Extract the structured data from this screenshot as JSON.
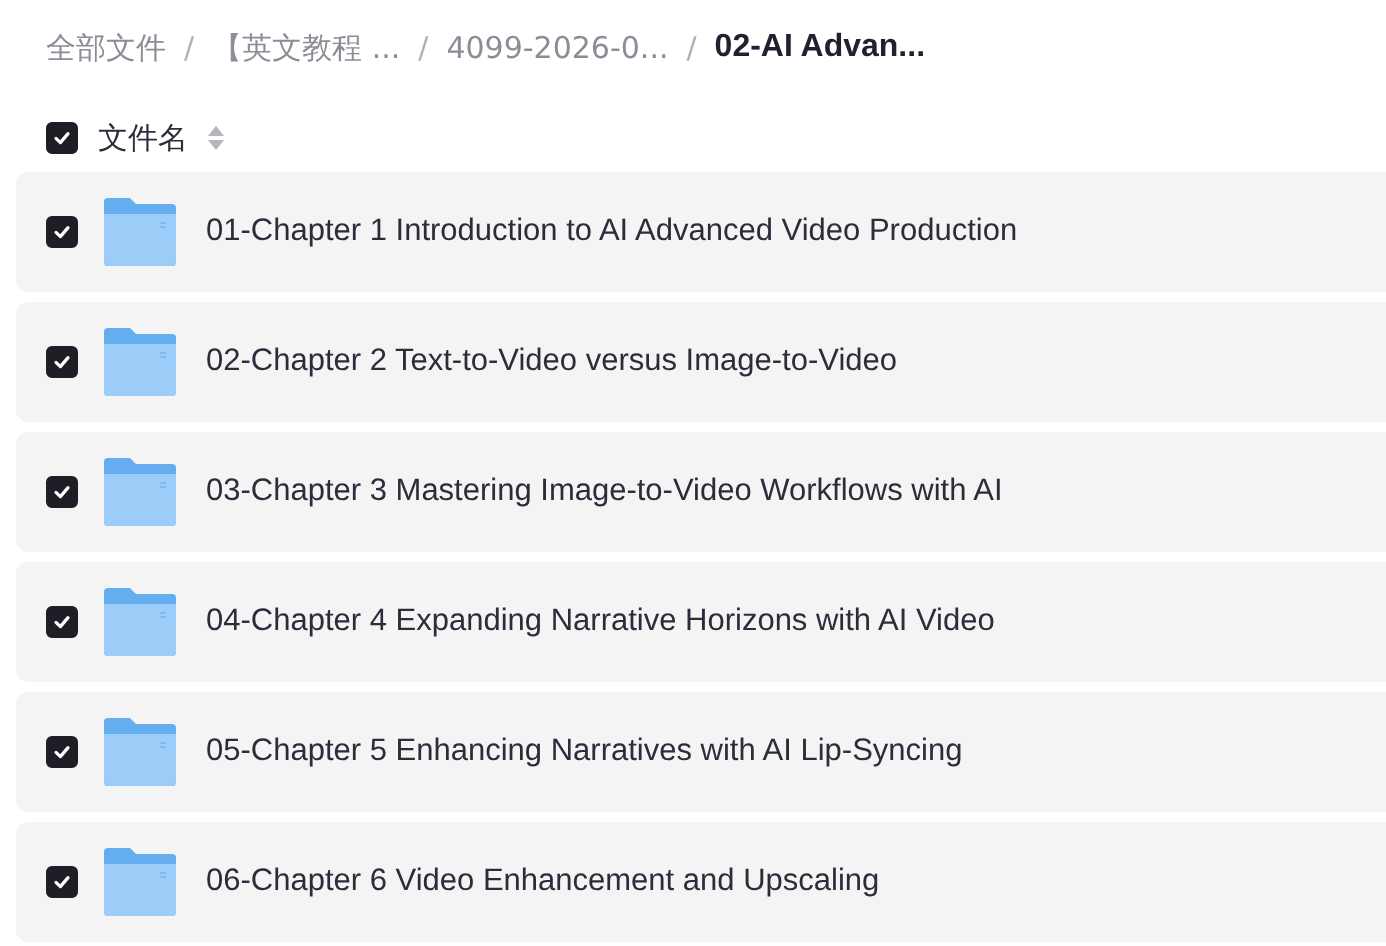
{
  "breadcrumb": [
    {
      "label": "全部文件",
      "current": false
    },
    {
      "separator": "/",
      "label": "【英文教程 ...",
      "current": false
    },
    {
      "separator": "/",
      "label": "4099-2026-0...",
      "current": false
    },
    {
      "separator": "/",
      "label": "02-AI Advan...",
      "current": true
    }
  ],
  "header": {
    "checked": true,
    "label": "文件名"
  },
  "rows": [
    {
      "checked": true,
      "name": "01-Chapter 1 Introduction to AI Advanced Video Production"
    },
    {
      "checked": true,
      "name": "02-Chapter 2 Text-to-Video versus Image-to-Video"
    },
    {
      "checked": true,
      "name": "03-Chapter 3 Mastering Image-to-Video Workflows with AI"
    },
    {
      "checked": true,
      "name": "04-Chapter 4 Expanding Narrative Horizons with AI Video"
    },
    {
      "checked": true,
      "name": "05-Chapter 5 Enhancing Narratives with AI Lip-Syncing"
    },
    {
      "checked": true,
      "name": "06-Chapter 6 Video Enhancement and Upscaling"
    }
  ]
}
